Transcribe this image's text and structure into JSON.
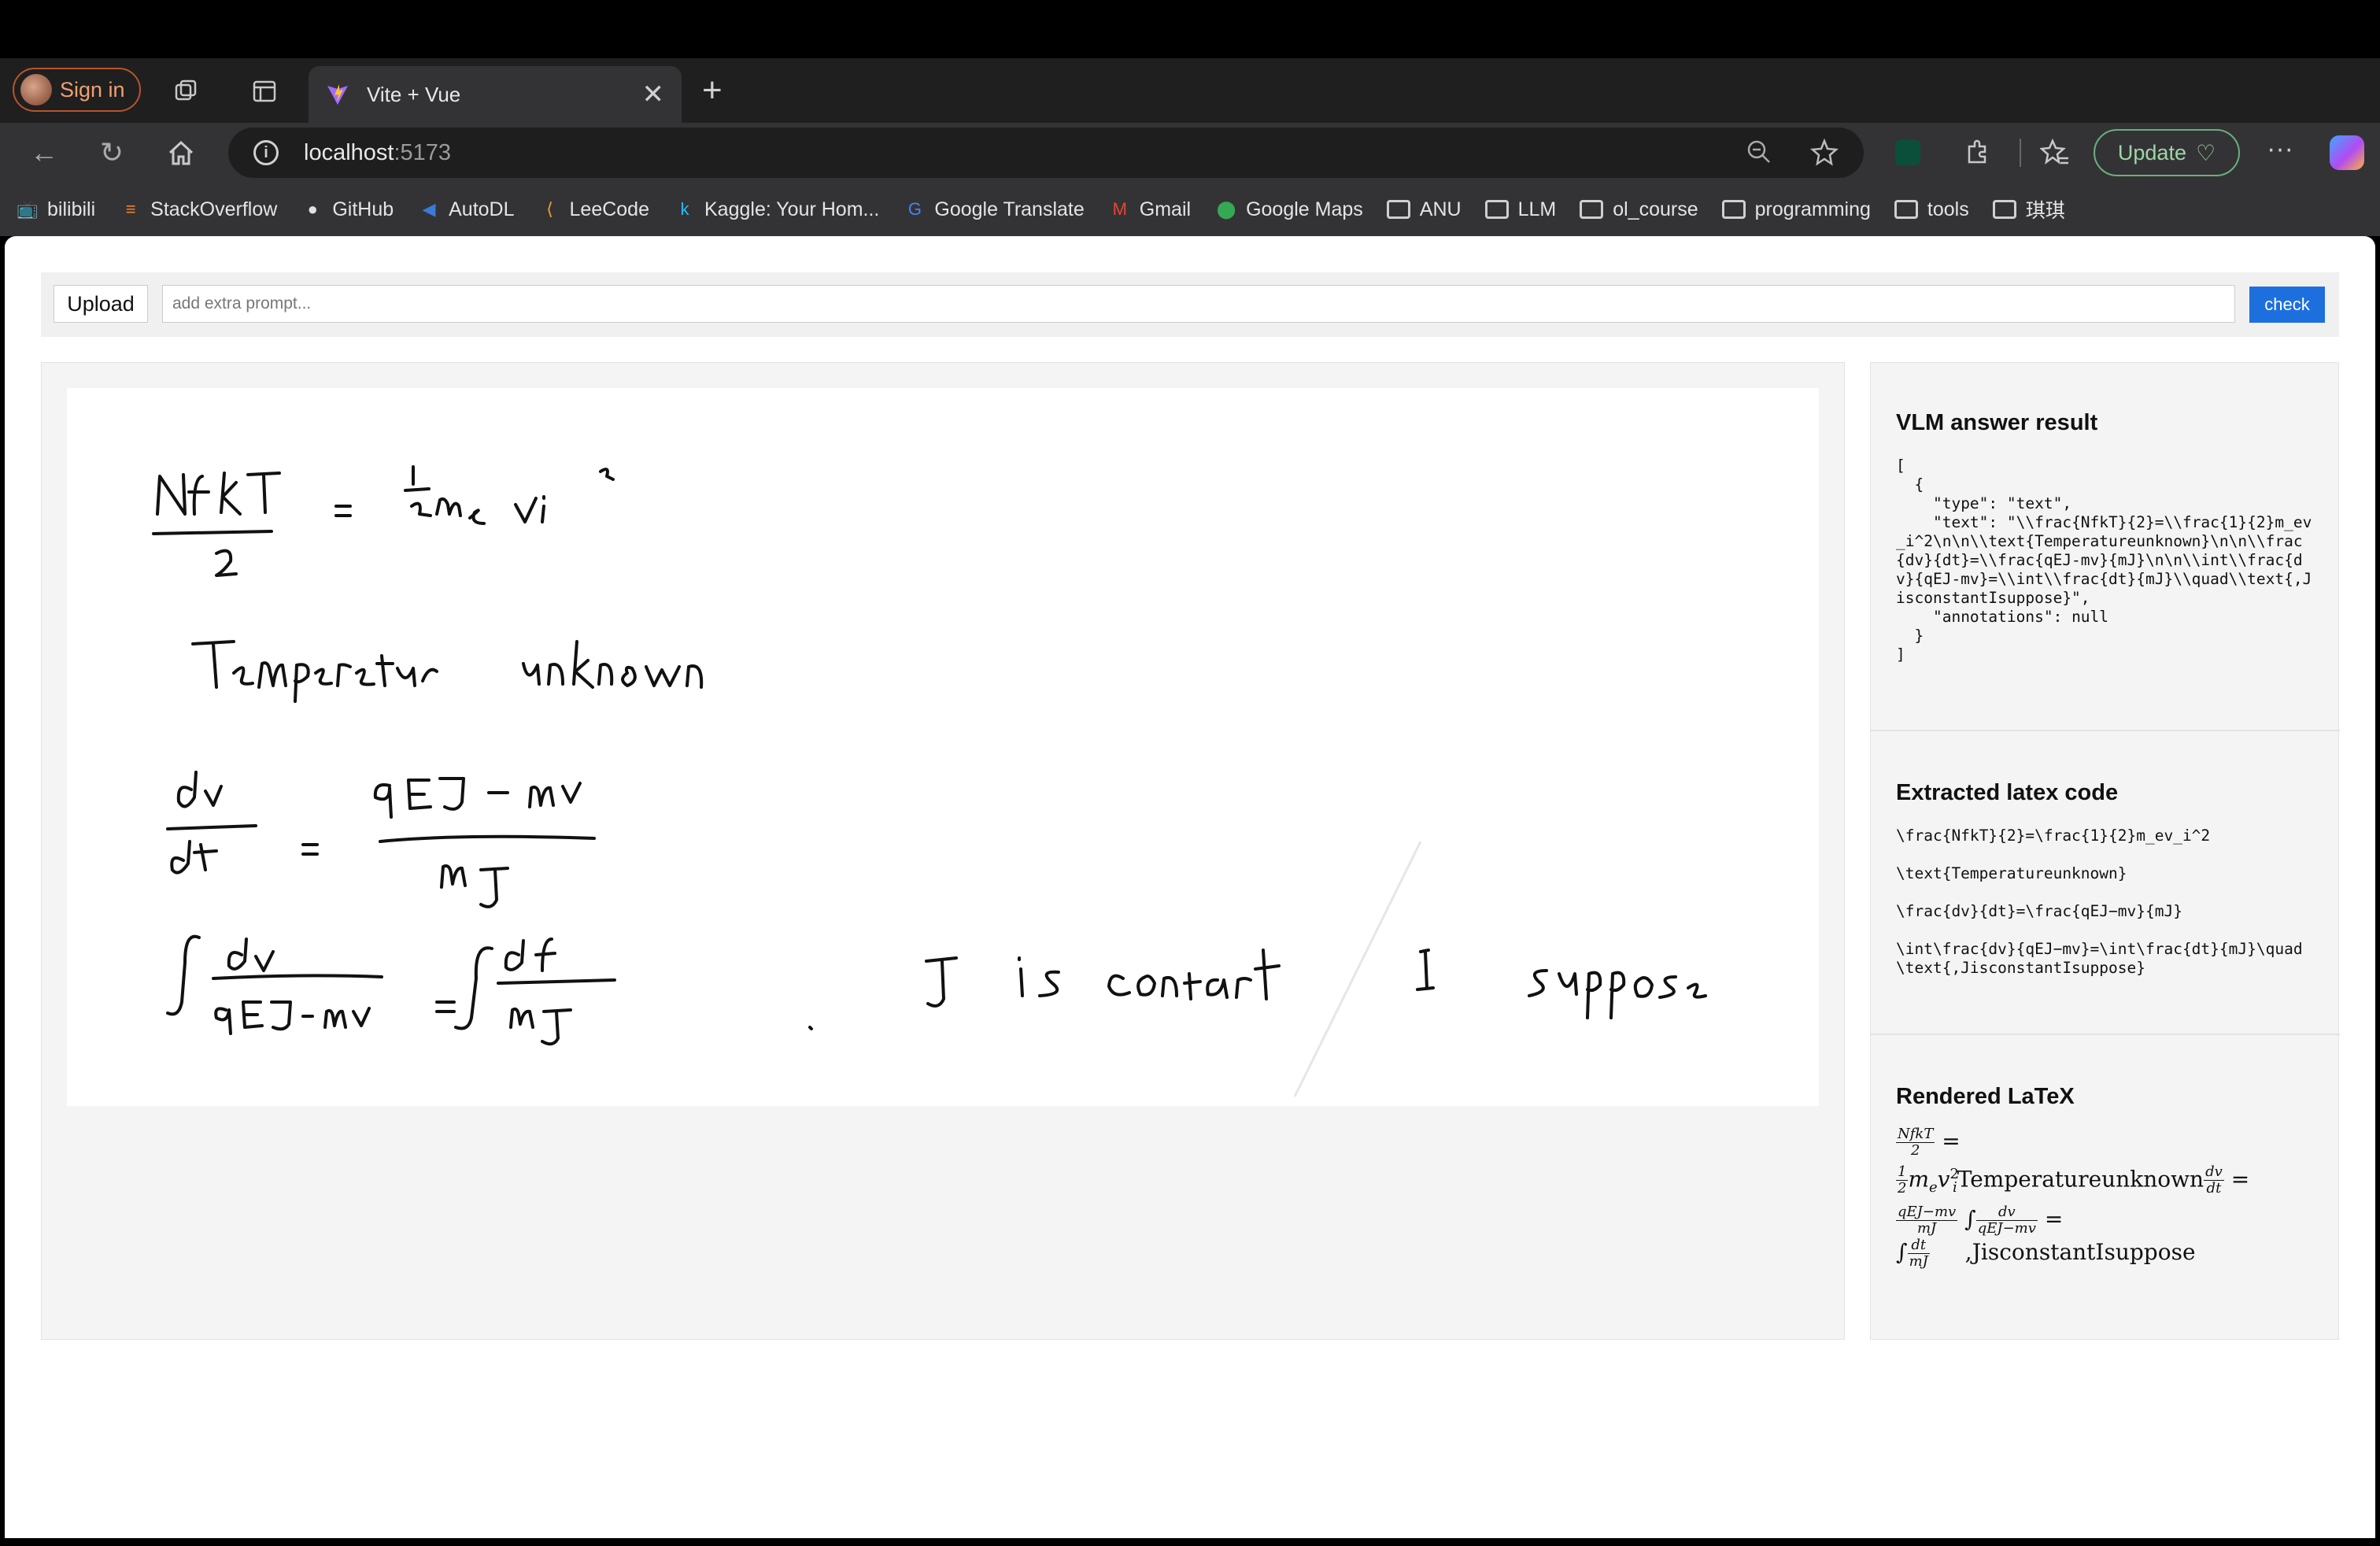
{
  "browser": {
    "signin_label": "Sign in",
    "tab_title": "Vite + Vue",
    "tab_close": "✕",
    "new_tab": "+",
    "url_host": "localhost",
    "url_port": ":5173",
    "update_label": "Update",
    "more_label": "···",
    "bookmarks": [
      {
        "label": "bilibili",
        "icon": "bilibili-icon"
      },
      {
        "label": "StackOverflow",
        "icon": "stackoverflow-icon"
      },
      {
        "label": "GitHub",
        "icon": "github-icon"
      },
      {
        "label": "AutoDL",
        "icon": "autodl-icon"
      },
      {
        "label": "LeeCode",
        "icon": "leetcode-icon"
      },
      {
        "label": "Kaggle: Your Hom...",
        "icon": "kaggle-icon"
      },
      {
        "label": "Google Translate",
        "icon": "translate-icon"
      },
      {
        "label": "Gmail",
        "icon": "gmail-icon"
      },
      {
        "label": "Google Maps",
        "icon": "maps-icon"
      },
      {
        "label": "ANU",
        "icon": "folder-icon"
      },
      {
        "label": "LLM",
        "icon": "folder-icon"
      },
      {
        "label": "ol_course",
        "icon": "folder-icon"
      },
      {
        "label": "programming",
        "icon": "folder-icon"
      },
      {
        "label": "tools",
        "icon": "folder-icon"
      },
      {
        "label": "琪琪",
        "icon": "folder-icon"
      }
    ]
  },
  "app": {
    "upload_label": "Upload",
    "prompt_placeholder": "add extra prompt...",
    "check_label": "check",
    "vlm_title": "VLM answer result",
    "vlm_json": "[\n  {\n    \"type\": \"text\",\n    \"text\": \"\\\\frac{NfkT}{2}=\\\\frac{1}{2}m_ev_i^2\\n\\n\\\\text{Temperatureunknown}\\n\\n\\\\frac{dv}{dt}=\\\\frac{qEJ-mv}{mJ}\\n\\n\\\\int\\\\frac{dv}{qEJ-mv}=\\\\int\\\\frac{dt}{mJ}\\\\quad\\\\text{,JisconstantIsuppose}\",\n    \"annotations\": null\n  }\n]",
    "latex_title": "Extracted latex code",
    "latex_lines": [
      "\\frac{NfkT}{2}=\\frac{1}{2}m_ev_i^2",
      "\\text{Temperatureunknown}",
      "\\frac{dv}{dt}=\\frac{qEJ−mv}{mJ}",
      "\\int\\frac{dv}{qEJ−mv}=\\int\\frac{dt}{mJ}\\quad\\text{,JisconstantIsuppose}"
    ],
    "rendered_title": "Rendered LaTeX",
    "rendered": {
      "f1_num": "NfkT",
      "f1_den": "2",
      "eq": "=",
      "half_num": "1",
      "half_den": "2",
      "mev": "m",
      "sub_e": "e",
      "v": "v",
      "sup2": "2",
      "sub_i": "i",
      "temp": "Temperatureunknown",
      "dv": "dv",
      "dt": "dt",
      "rhs_num": "qEJ−mv",
      "rhs_den": "mJ",
      "int": "∫",
      "int_den1": "qEJ−mv",
      "int_den2": "mJ",
      "tail": ",JisconstantIsuppose"
    }
  }
}
